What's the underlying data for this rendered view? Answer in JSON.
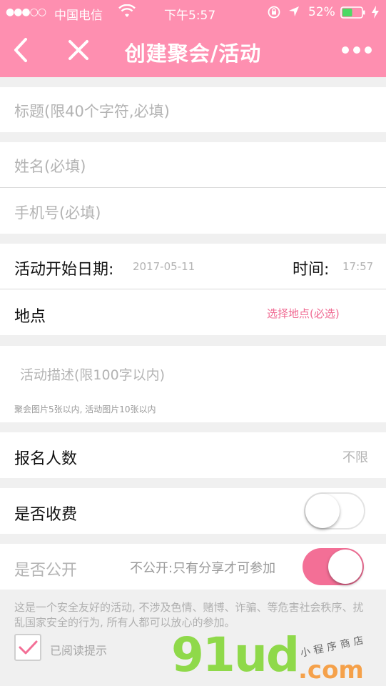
{
  "status_bar": {
    "signal": "●●●○○",
    "carrier": "中国电信",
    "time": "下午5:57",
    "battery_percent": "52%",
    "battery_level": 0.52
  },
  "nav": {
    "title": "创建聚会/活动"
  },
  "form": {
    "title_placeholder": "标题(限40个字符,必填)",
    "name_placeholder": "姓名(必填)",
    "phone_placeholder": "手机号(必填)",
    "start_date_label": "活动开始日期:",
    "start_date_value": "2017-05-11",
    "time_label": "时间:",
    "time_value": "17:57",
    "location_label": "地点",
    "location_action": "选择地点(必选)",
    "description_placeholder": "活动描述(限100字以内)",
    "image_hint": "聚会图片5张以内, 活动图片10张以内",
    "signup_label": "报名人数",
    "signup_value": "不限",
    "fee_label": "是否收费",
    "fee_enabled": false,
    "public_label": "是否公开",
    "public_hint": "不公开:只有分享才可参加",
    "public_toggle_on": true
  },
  "notice": {
    "text": "这是一个安全友好的活动, 不涉及色情、赌博、诈骗、等危害社会秩序、扰乱国家安全的行为, 所有人都可以放心的参加。",
    "agree_label": "已阅读提示",
    "agree_checked": true
  },
  "watermark": {
    "brand": "91ud",
    "domain": ".com",
    "tagline": "小程序商店"
  },
  "colors": {
    "accent": "#fe8fb0",
    "toggle_on": "#f36f96",
    "placeholder": "#b3b3b3",
    "location_action": "#f06a92"
  }
}
